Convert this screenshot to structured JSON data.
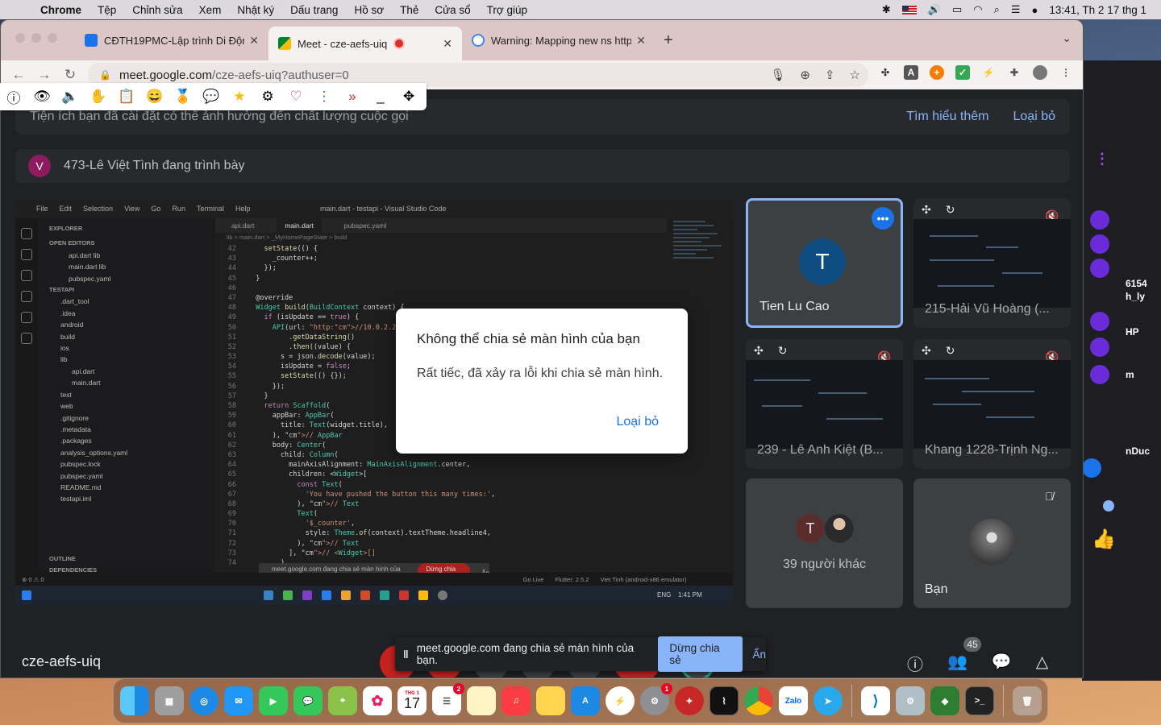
{
  "menubar": {
    "app_name": "Chrome",
    "items": [
      "Tệp",
      "Chỉnh sửa",
      "Xem",
      "Nhật ký",
      "Dấu trang",
      "Hồ sơ",
      "Thẻ",
      "Cửa sổ",
      "Trợ giúp"
    ],
    "clock": "13:41, Th 2 17 thg 1"
  },
  "tabs": [
    {
      "title": "CĐTH19PMC-Lập trình Di Động",
      "favicon_color": "#1a73e8"
    },
    {
      "title": "Meet - cze-aefs-uiq",
      "favicon_color": "#00897b",
      "recording": true
    },
    {
      "title": "Warning: Mapping new ns http:",
      "favicon_color": "#4285f4"
    }
  ],
  "omnibox": {
    "url_host": "meet.google.com",
    "url_path": "/cze-aefs-uiq?authuser=0"
  },
  "banner": {
    "text": "Tiện ích bạn đã cài đặt có thể ảnh hưởng đến chất lượng cuộc gọi",
    "learn_more": "Tìm hiểu thêm",
    "dismiss": "Loại bỏ"
  },
  "presenter": {
    "initial": "V",
    "text": "473-Lê Việt Tình đang trình bày"
  },
  "vscode": {
    "menu": [
      "File",
      "Edit",
      "Selection",
      "View",
      "Go",
      "Run",
      "Terminal",
      "Help"
    ],
    "window_title": "main.dart - testapi - Visual Studio Code",
    "explorer_title": "EXPLORER",
    "open_editors": "OPEN EDITORS",
    "open_files": [
      "api.dart  lib",
      "main.dart  lib",
      "pubspec.yaml"
    ],
    "project": "TESTAPI",
    "files": [
      ".dart_tool",
      ".idea",
      "android",
      "build",
      "ios",
      "lib",
      "api.dart",
      "main.dart",
      "test",
      "web",
      ".gitignore",
      ".metadata",
      ".packages",
      "analysis_options.yaml",
      "pubspec.lock",
      "pubspec.yaml",
      "README.md",
      "testapi.iml"
    ],
    "outline": "OUTLINE",
    "dependencies": "DEPENDENCIES",
    "editor_tabs": [
      "api.dart",
      "main.dart",
      "pubspec.yaml"
    ],
    "breadcrumb": "lib > main.dart > _MyHomePageState > build",
    "line_start": 42,
    "lines": [
      "    setState(() {",
      "      _counter++;",
      "    });",
      "  }",
      "",
      "  @override",
      "  Widget build(BuildContext context) {",
      "    if (isUpdate == true) {",
      "      API(url: \"http://10.0.2.2:8000",
      "          .getDataString()",
      "          .then((value) {",
      "        s = json.decode(value);",
      "        isUpdate = false;",
      "        setState(() {});",
      "      });",
      "    }",
      "    return Scaffold(",
      "      appBar: AppBar(",
      "        title: Text(widget.title),",
      "      ), // AppBar",
      "      body: Center(",
      "        child: Column(",
      "          mainAxisAlignment: MainAxisAlignment.center,",
      "          children: <Widget>[",
      "            const Text(",
      "              'You have pushed the button this many times:',",
      "            ), // Text",
      "            Text(",
      "              '$_counter',",
      "              style: Theme.of(context).textTheme.headline4,",
      "            ), // Text",
      "          ], // <Widget>[]",
      "        ),"
    ],
    "status": [
      "⊗ 0 ⚠ 0",
      "Go Live",
      "Flutter: 2.5.2",
      "Viet Tinh (android-x86 emulator)"
    ],
    "share_text": "meet.google.com đang chia sẻ màn hình của bạn.",
    "share_stop": "Dừng chia sẻ",
    "share_hide": "Ẩn",
    "taskbar_time": "1:41 PM",
    "taskbar_lang": "ENG"
  },
  "participants": [
    {
      "name": "Tien Lu Cao",
      "initial": "T"
    },
    {
      "name": "215-Hải Vũ Hoàng (..."
    },
    {
      "name": "239 - Lê Anh Kiệt (B..."
    },
    {
      "name": "Khang 1228-Trịnh Ng..."
    },
    {
      "name": "39 người khác",
      "initial": "T"
    },
    {
      "name": "Bạn"
    }
  ],
  "meeting_code": "cze-aefs-uiq",
  "participant_count": "45",
  "dialog": {
    "title": "Không thể chia sẻ màn hình của bạn",
    "message": "Rất tiếc, đã xảy ra lỗi khi chia sẻ màn hình.",
    "action": "Loại bỏ"
  },
  "share_bar": {
    "text": "meet.google.com đang chia sẻ màn hình của bạn.",
    "stop": "Dừng chia sẻ",
    "hide": "Ẩn"
  },
  "bg_app": {
    "texts": [
      "6154",
      "h_ly",
      "HP",
      "m",
      "nDuc"
    ]
  },
  "dock": {
    "calendar_month": "THG 1",
    "calendar_day": "17",
    "zalo_label": "Zalo",
    "reminders_badge": "2",
    "settings_badge": "1"
  }
}
